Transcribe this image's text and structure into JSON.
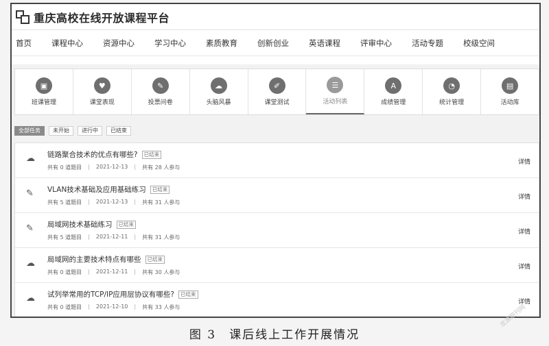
{
  "header": {
    "title": "重庆高校在线开放课程平台"
  },
  "nav": [
    "首页",
    "课程中心",
    "资源中心",
    "学习中心",
    "素质教育",
    "创新创业",
    "英语课程",
    "评审中心",
    "活动专题",
    "校级空间"
  ],
  "tools": [
    {
      "label": "班课管理",
      "icon": "calendar-icon",
      "glyph": "▣",
      "active": false
    },
    {
      "label": "课堂表现",
      "icon": "shield-icon",
      "glyph": "♥",
      "active": false
    },
    {
      "label": "投票问卷",
      "icon": "vote-icon",
      "glyph": "✎",
      "active": false
    },
    {
      "label": "头脑风暴",
      "icon": "brain-icon",
      "glyph": "☁",
      "active": false
    },
    {
      "label": "课堂测试",
      "icon": "edit-icon",
      "glyph": "✐",
      "active": false
    },
    {
      "label": "活动列表",
      "icon": "list-icon",
      "glyph": "☰",
      "active": true
    },
    {
      "label": "成绩管理",
      "icon": "score-icon",
      "glyph": "A",
      "active": false
    },
    {
      "label": "统计管理",
      "icon": "pie-icon",
      "glyph": "◔",
      "active": false
    },
    {
      "label": "活动库",
      "icon": "box-icon",
      "glyph": "▤",
      "active": false
    }
  ],
  "filters": [
    {
      "label": "全部任务",
      "active": true
    },
    {
      "label": "未开始",
      "active": false
    },
    {
      "label": "进行中",
      "active": false
    },
    {
      "label": "已结束",
      "active": false
    }
  ],
  "activities": [
    {
      "icon": "brain-icon",
      "glyph": "☁",
      "title": "链路聚合技术的优点有哪些?",
      "status": "已结束",
      "questions": "共有 0 道题目",
      "date": "2021-12-13",
      "participants": "共有 28 人参与",
      "detail": "详情"
    },
    {
      "icon": "edit-icon",
      "glyph": "✎",
      "title": "VLAN技术基础及应用基础练习",
      "status": "已结束",
      "questions": "共有 5 道题目",
      "date": "2021-12-13",
      "participants": "共有 31 人参与",
      "detail": "详情"
    },
    {
      "icon": "edit-icon",
      "glyph": "✎",
      "title": "局域网技术基础练习",
      "status": "已结束",
      "questions": "共有 5 道题目",
      "date": "2021-12-11",
      "participants": "共有 31 人参与",
      "detail": "详情"
    },
    {
      "icon": "brain-icon",
      "glyph": "☁",
      "title": "局域网的主要技术特点有哪些",
      "status": "已结束",
      "questions": "共有 0 道题目",
      "date": "2021-12-11",
      "participants": "共有 30 人参与",
      "detail": "详情"
    },
    {
      "icon": "brain-icon",
      "glyph": "☁",
      "title": "试列举常用的TCP/IP应用层协议有哪些?",
      "status": "已结束",
      "questions": "共有 0 道题目",
      "date": "2021-12-10",
      "participants": "共有 33 人参与",
      "detail": "详情"
    }
  ],
  "caption": "图 3　课后线上工作开展情况",
  "watermark": "龙源期刊网"
}
